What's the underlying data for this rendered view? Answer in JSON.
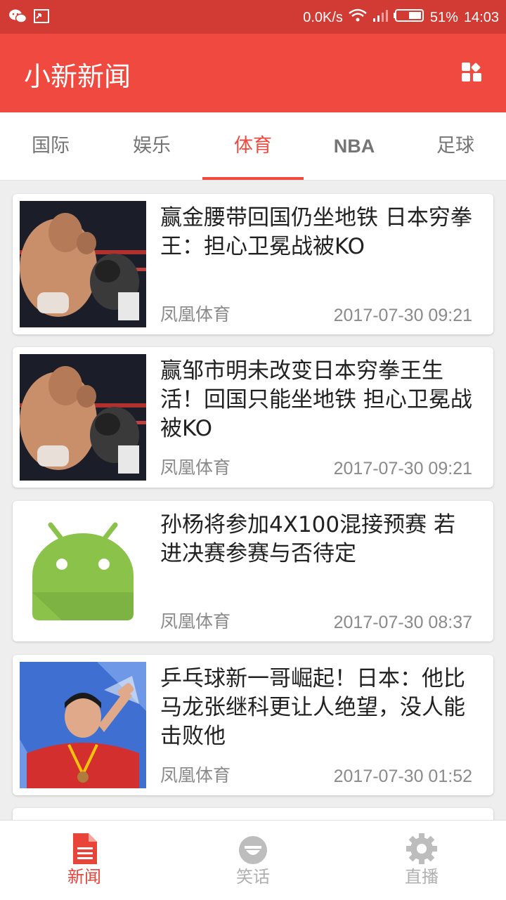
{
  "status": {
    "speed": "0.0K/s",
    "battery": "51%",
    "time": "14:03"
  },
  "app": {
    "title": "小新新闻"
  },
  "tabs": [
    {
      "label": "国际",
      "active": false
    },
    {
      "label": "娱乐",
      "active": false
    },
    {
      "label": "体育",
      "active": true
    },
    {
      "label": "NBA",
      "active": false
    },
    {
      "label": "足球",
      "active": false
    }
  ],
  "news": [
    {
      "title": "赢金腰带回国仍坐地铁 日本穷拳王：担心卫冕战被KO",
      "source": "凤凰体育",
      "time": "2017-07-30 09:21",
      "thumb": "boxing-photo"
    },
    {
      "title": "赢邹市明未改变日本穷拳王生活！回国只能坐地铁 担心卫冕战被KO",
      "source": "凤凰体育",
      "time": "2017-07-30 09:21",
      "thumb": "boxing-photo"
    },
    {
      "title": "孙杨将参加4X100混接预赛 若进决赛参赛与否待定",
      "source": "凤凰体育",
      "time": "2017-07-30 08:37",
      "thumb": "android-placeholder"
    },
    {
      "title": "乒乓球新一哥崛起！日本：他比马龙张继科更让人绝望，没人能击败他",
      "source": "凤凰体育",
      "time": "2017-07-30 01:52",
      "thumb": "athlete-salute-photo"
    }
  ],
  "nav": [
    {
      "label": "新闻",
      "icon": "document-icon",
      "active": true
    },
    {
      "label": "笑话",
      "icon": "smile-icon",
      "active": false
    },
    {
      "label": "直播",
      "icon": "gear-icon",
      "active": false
    }
  ],
  "colors": {
    "primary": "#f04a40",
    "status_bar": "#d13b33"
  }
}
